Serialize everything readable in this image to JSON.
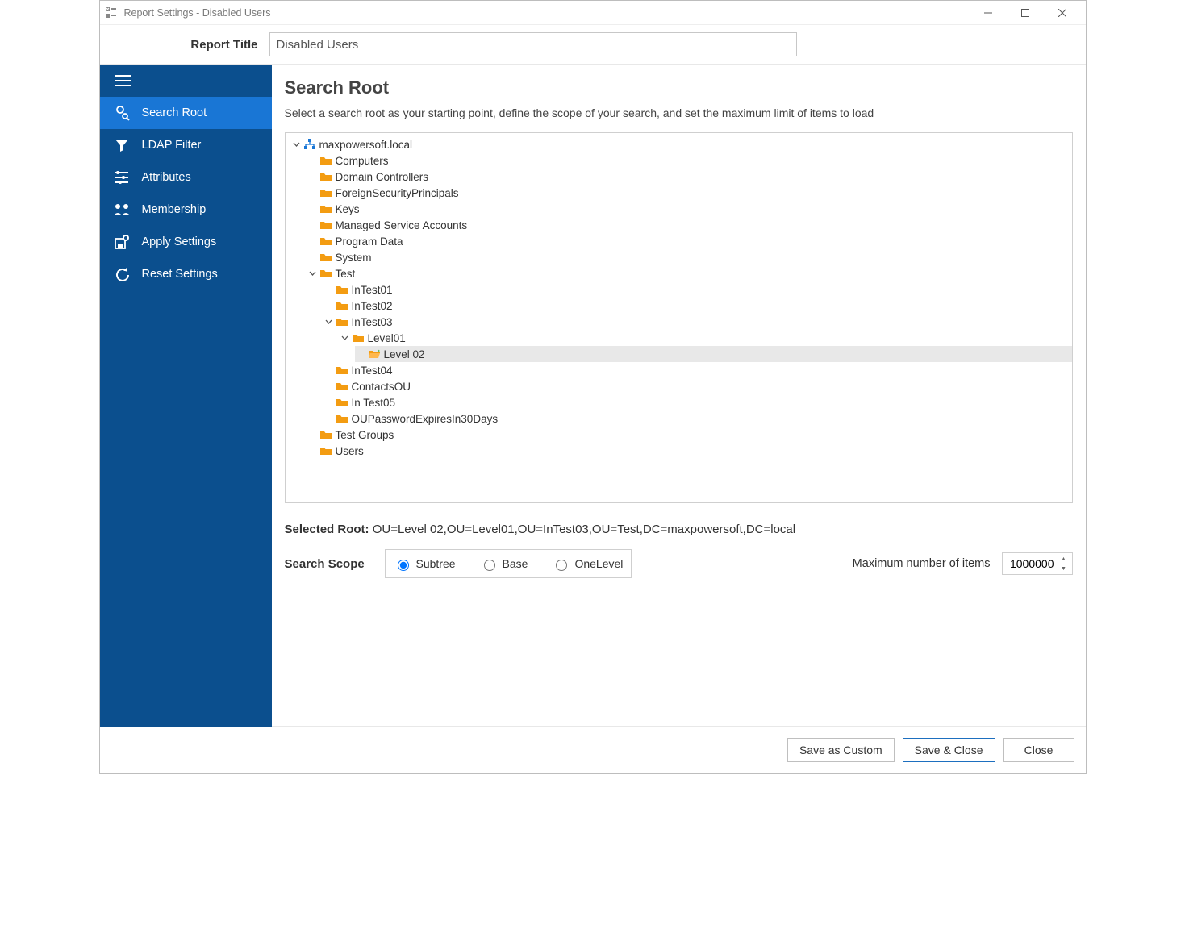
{
  "window": {
    "title": "Report Settings - Disabled Users"
  },
  "header": {
    "label": "Report Title",
    "value": "Disabled Users"
  },
  "sidebar": {
    "items": [
      {
        "label": "Search Root",
        "icon": "search-root-icon",
        "selected": true
      },
      {
        "label": "LDAP Filter",
        "icon": "filter-icon",
        "selected": false
      },
      {
        "label": "Attributes",
        "icon": "attributes-icon",
        "selected": false
      },
      {
        "label": "Membership",
        "icon": "membership-icon",
        "selected": false
      },
      {
        "label": "Apply Settings",
        "icon": "apply-icon",
        "selected": false
      },
      {
        "label": "Reset Settings",
        "icon": "reset-icon",
        "selected": false
      }
    ]
  },
  "main": {
    "heading": "Search Root",
    "description": "Select a search root as your starting point, define the scope of your search, and set the maximum limit of items to load",
    "selected_root_label": "Selected Root:",
    "selected_root_value": "OU=Level 02,OU=Level01,OU=InTest03,OU=Test,DC=maxpowersoft,DC=local",
    "search_scope_label": "Search Scope",
    "scopes": {
      "subtree": "Subtree",
      "base": "Base",
      "onelevel": "OneLevel",
      "selected": "subtree"
    },
    "max_items_label": "Maximum number of items",
    "max_items_value": "1000000"
  },
  "tree": {
    "root": {
      "label": "maxpowersoft.local",
      "type": "domain",
      "expanded": true,
      "children": [
        {
          "label": "Computers",
          "type": "folder"
        },
        {
          "label": "Domain Controllers",
          "type": "folder"
        },
        {
          "label": "ForeignSecurityPrincipals",
          "type": "folder"
        },
        {
          "label": "Keys",
          "type": "folder"
        },
        {
          "label": "Managed Service Accounts",
          "type": "folder"
        },
        {
          "label": "Program Data",
          "type": "folder"
        },
        {
          "label": "System",
          "type": "folder"
        },
        {
          "label": "Test",
          "type": "folder",
          "expanded": true,
          "children": [
            {
              "label": "InTest01",
              "type": "folder"
            },
            {
              "label": "InTest02",
              "type": "folder"
            },
            {
              "label": "InTest03",
              "type": "folder",
              "expanded": true,
              "children": [
                {
                  "label": "Level01",
                  "type": "folder",
                  "expanded": true,
                  "children": [
                    {
                      "label": "Level 02",
                      "type": "folder-open",
                      "selected": true
                    }
                  ]
                }
              ]
            },
            {
              "label": "InTest04",
              "type": "folder"
            },
            {
              "label": "ContactsOU",
              "type": "folder"
            },
            {
              "label": "In Test05",
              "type": "folder"
            },
            {
              "label": "OUPasswordExpiresIn30Days",
              "type": "folder"
            }
          ]
        },
        {
          "label": "Test Groups",
          "type": "folder"
        },
        {
          "label": "Users",
          "type": "folder"
        }
      ]
    }
  },
  "footer": {
    "save_custom": "Save as Custom",
    "save_close": "Save & Close",
    "close": "Close"
  }
}
